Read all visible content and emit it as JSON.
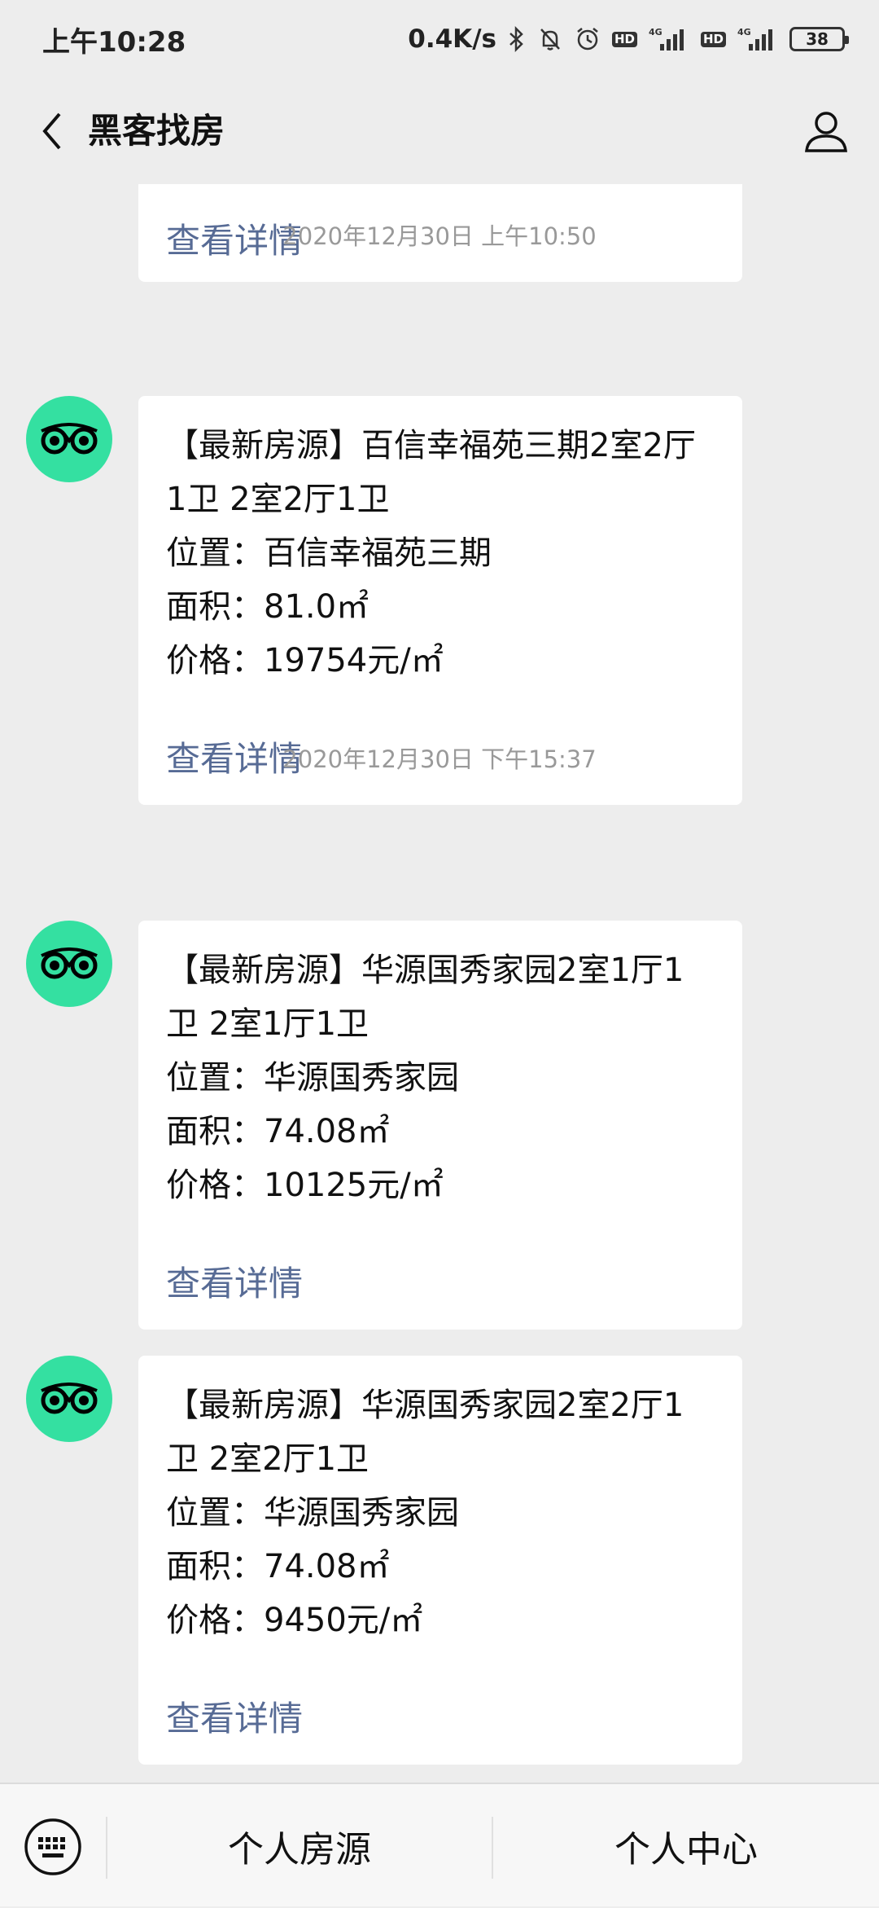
{
  "status_bar": {
    "time": "上午10:28",
    "net_speed": "0.4K/s",
    "signal1_label": "4G",
    "signal2_label": "4G",
    "hd1": "HD",
    "hd2": "HD",
    "battery": "38"
  },
  "nav": {
    "title": "黑客找房",
    "back_icon": "chevron-left-icon",
    "profile_icon": "person-icon"
  },
  "chat": {
    "top_partial": {
      "detail_label": "查看详情"
    },
    "timestamps": [
      "2020年12月30日 上午10:50",
      "2020年12月30日 下午15:37"
    ],
    "messages": [
      {
        "title": "【最新房源】百信幸福苑三期2室2厅1卫 2室2厅1卫",
        "location": "位置：百信幸福苑三期",
        "area": "面积：81.0㎡",
        "price": "价格：19754元/㎡",
        "detail_label": "查看详情"
      },
      {
        "title": "【最新房源】华源国秀家园2室1厅1卫 2室1厅1卫",
        "location": "位置：华源国秀家园",
        "area": "面积：74.08㎡",
        "price": "价格：10125元/㎡",
        "detail_label": "查看详情"
      },
      {
        "title": "【最新房源】华源国秀家园2室2厅1卫 2室2厅1卫",
        "location": "位置：华源国秀家园",
        "area": "面积：74.08㎡",
        "price": "价格：9450元/㎡",
        "detail_label": "查看详情"
      }
    ],
    "avatar_icon": "owl-logo-icon",
    "avatar_color": "#34e0a1",
    "link_color": "#576b95"
  },
  "bottom_bar": {
    "keyboard_icon": "keyboard-icon",
    "menu": [
      "个人房源",
      "个人中心"
    ]
  }
}
